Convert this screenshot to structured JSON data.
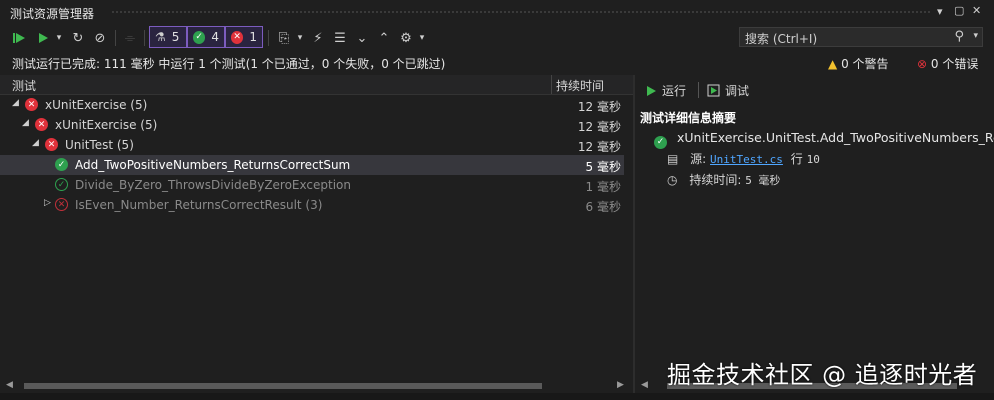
{
  "window": {
    "title": "测试资源管理器",
    "pin_icon": "▾",
    "restore_icon": "▢",
    "close_icon": "✕"
  },
  "toolbar": {
    "counters": {
      "total": "5",
      "passed": "4",
      "failed": "1"
    }
  },
  "search": {
    "placeholder": "搜索 (Ctrl+I)"
  },
  "status": {
    "message": "测试运行已完成: 111 毫秒 中运行 1 个测试(1 个已通过，0 个失败，0 个已跳过)",
    "warnings": "0 个警告",
    "errors": "0 个错误"
  },
  "columns": {
    "test": "测试",
    "duration": "持续时间"
  },
  "tree": [
    {
      "label": "xUnitExercise (5)",
      "duration": "12 毫秒",
      "status": "failed",
      "level": 0,
      "expanded": true
    },
    {
      "label": "xUnitExercise (5)",
      "duration": "12 毫秒",
      "status": "failed",
      "level": 1,
      "expanded": true
    },
    {
      "label": "UnitTest (5)",
      "duration": "12 毫秒",
      "status": "failed",
      "level": 2,
      "expanded": true
    },
    {
      "label": "Add_TwoPositiveNumbers_ReturnsCorrectSum",
      "duration": "5 毫秒",
      "status": "passed",
      "level": 3,
      "selected": true
    },
    {
      "label": "Divide_ByZero_ThrowsDivideByZeroException",
      "duration": "1 毫秒",
      "status": "passed",
      "level": 3,
      "dim": true
    },
    {
      "label": "IsEven_Number_ReturnsCorrectResult (3)",
      "duration": "6 毫秒",
      "status": "failed",
      "level": 3,
      "dim": true,
      "collapsed": true
    }
  ],
  "detail": {
    "run_label": "运行",
    "debug_label": "调试",
    "summary_title": "测试详细信息摘要",
    "test_name": "xUnitExercise.UnitTest.Add_TwoPositiveNumbers_Re",
    "source_label": "源:",
    "source_file": "UnitTest.cs",
    "line_label": "行",
    "line_number": "10",
    "duration_label": "持续时间:",
    "duration_value": "5 毫秒"
  },
  "watermark": "掘金技术社区 @ 追逐时光者",
  "colors": {
    "passed": "#2ea04f",
    "failed": "#e0323b",
    "accent": "#7c5cbf",
    "link": "#4fa6ff"
  }
}
